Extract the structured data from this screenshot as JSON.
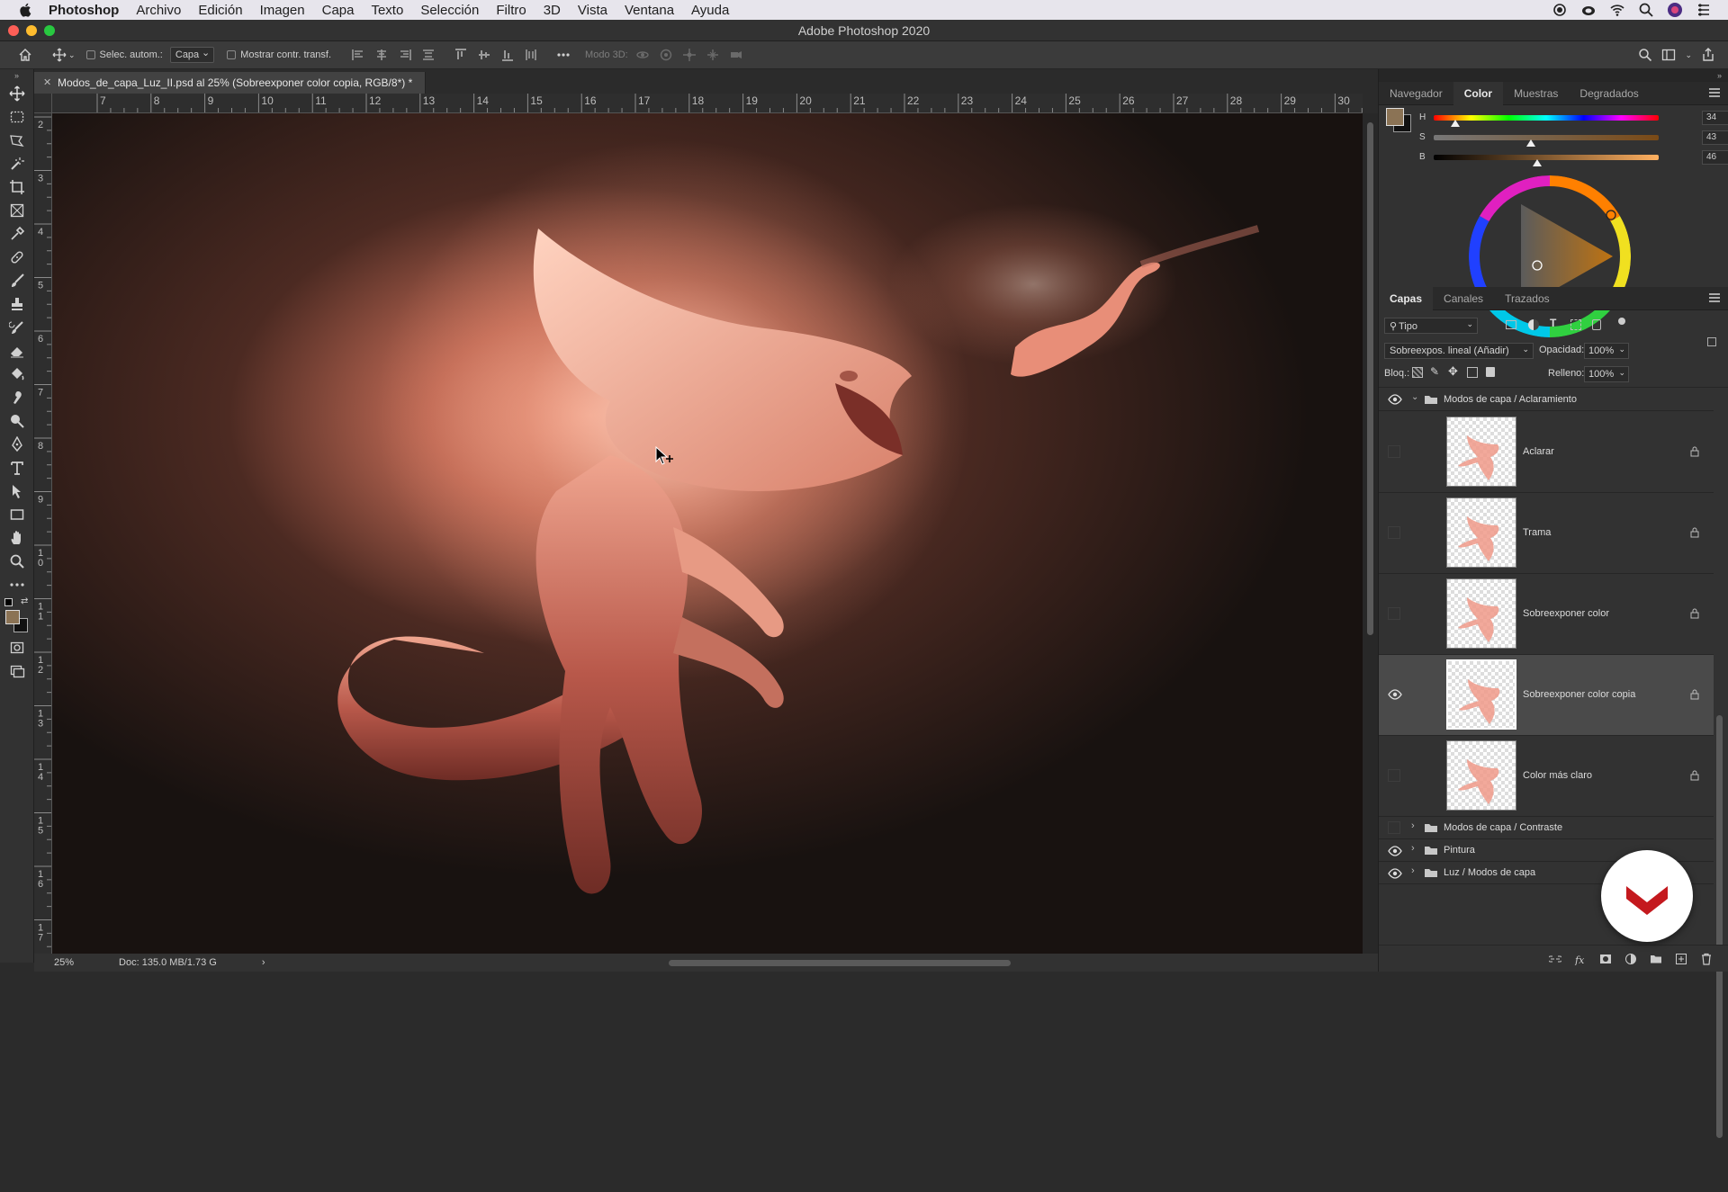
{
  "menubar": {
    "items": [
      "Photoshop",
      "Archivo",
      "Edición",
      "Imagen",
      "Capa",
      "Texto",
      "Selección",
      "Filtro",
      "3D",
      "Vista",
      "Ventana",
      "Ayuda"
    ]
  },
  "window": {
    "title": "Adobe Photoshop 2020"
  },
  "options_bar": {
    "auto_select_label": "Selec. autom.:",
    "auto_select_value": "Capa",
    "show_transform_label": "Mostrar contr. transf.",
    "mode_3d_label": "Modo 3D:"
  },
  "document": {
    "tab_title": "Modos_de_capa_Luz_II.psd al 25% (Sobreexponer color copia, RGB/8*) *",
    "ruler_h": [
      "7",
      "8",
      "9",
      "10",
      "11",
      "12",
      "13",
      "14",
      "15",
      "16",
      "17",
      "18",
      "19",
      "20",
      "21",
      "22",
      "23",
      "24",
      "25",
      "26",
      "27",
      "28",
      "29",
      "30"
    ],
    "ruler_v": [
      "2",
      "3",
      "4",
      "5",
      "6",
      "7",
      "8",
      "9",
      "1\n0",
      "1\n1",
      "1\n2",
      "1\n3",
      "1\n4",
      "1\n5",
      "1\n6",
      "1\n7"
    ]
  },
  "status": {
    "zoom": "25%",
    "doc_info": "Doc: 135.0 MB/1.73 G",
    "arrow": "›"
  },
  "color_panel": {
    "tabs": [
      "Navegador",
      "Color",
      "Muestras",
      "Degradados"
    ],
    "active_tab": "Color",
    "foreground": "#8b7355",
    "background": "#111111",
    "h": {
      "label": "H",
      "value": "34",
      "unit": "°",
      "level": 0.094
    },
    "s": {
      "label": "S",
      "value": "43",
      "unit": "%",
      "level": 0.43
    },
    "b": {
      "label": "B",
      "value": "46",
      "unit": "%",
      "level": 0.46
    }
  },
  "layers_panel": {
    "tabs": [
      "Capas",
      "Canales",
      "Trazados"
    ],
    "active_tab": "Capas",
    "filter_label": "Tipo",
    "blend_mode": "Sobreexpos. lineal (Añadir)",
    "opacity_label": "Opacidad:",
    "opacity_value": "100%",
    "lock_label": "Bloq.:",
    "fill_label": "Relleno:",
    "fill_value": "100%",
    "group_open": {
      "name": "Modos de capa / Aclaramiento",
      "visible": true
    },
    "layers": [
      {
        "name": "Aclarar",
        "visible": false,
        "selected": false
      },
      {
        "name": "Trama",
        "visible": false,
        "selected": false
      },
      {
        "name": "Sobreexponer color",
        "visible": false,
        "selected": false
      },
      {
        "name": "Sobreexponer color copia",
        "visible": true,
        "selected": true
      },
      {
        "name": "Color más claro",
        "visible": false,
        "selected": false
      }
    ],
    "groups_closed": [
      {
        "name": "Modos de capa / Contraste",
        "visible": false
      },
      {
        "name": "Pintura",
        "visible": true
      },
      {
        "name": "Luz / Modos de capa",
        "visible": true
      }
    ]
  },
  "accent": "#c4191e"
}
